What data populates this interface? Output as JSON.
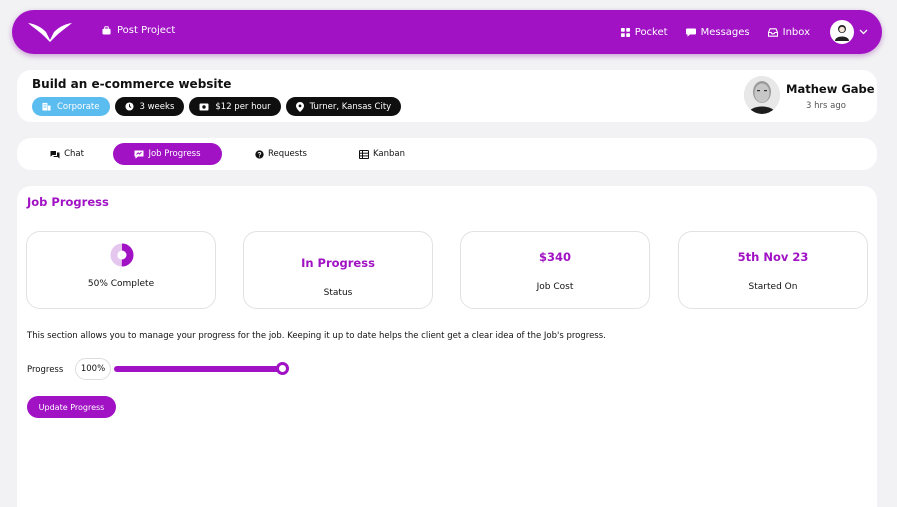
{
  "nav": {
    "post_project": "Post Project",
    "pocket": "Pocket",
    "messages": "Messages",
    "inbox": "Inbox"
  },
  "project": {
    "title": "Build an e-commerce website",
    "tags": {
      "category": "Corporate",
      "duration": "3 weeks",
      "rate": "$12 per hour",
      "location": "Turner, Kansas City"
    },
    "client_name": "Mathew Gabe",
    "client_time": "3 hrs ago"
  },
  "tabs": {
    "chat": "Chat",
    "job_progress": "Job Progress",
    "requests": "Requests",
    "kanban": "Kanban"
  },
  "job_progress": {
    "title": "Job Progress",
    "complete_label": "50% Complete",
    "complete_fraction": 0.5,
    "status_value": "In Progress",
    "status_label": "Status",
    "cost_value": "$340",
    "cost_label": "Job Cost",
    "started_value": "5th Nov 23",
    "started_label": "Started On",
    "description": "This section allows you to manage your progress for the job. Keeping it up to date helps the client get a clear idea of the Job's progress.",
    "progress_label": "Progress",
    "progress_value": "100%",
    "progress_fraction": 1.0,
    "update_button": "Update Progress"
  },
  "colors": {
    "accent": "#a012c4",
    "corporate_tag": "#5bbcf0"
  }
}
